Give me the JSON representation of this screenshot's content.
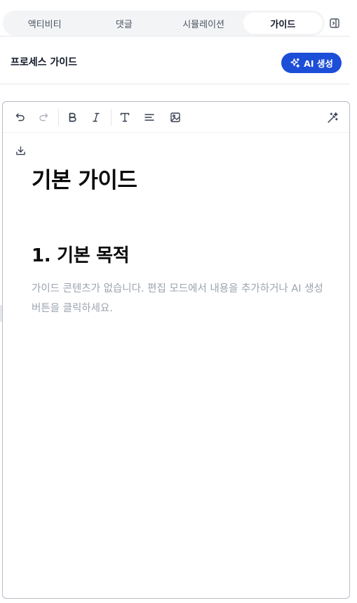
{
  "tabs": [
    {
      "label": "액티비티",
      "active": false
    },
    {
      "label": "댓글",
      "active": false
    },
    {
      "label": "시뮬레이션",
      "active": false
    },
    {
      "label": "가이드",
      "active": true
    }
  ],
  "header": {
    "title": "프로세스 가이드",
    "ai_button_label": "AI 생성"
  },
  "toolbar": {
    "buttons": [
      "undo-icon",
      "redo-icon",
      "bold-icon",
      "italic-icon",
      "heading-icon",
      "align-icon",
      "image-icon",
      "magic-wand-icon"
    ]
  },
  "document": {
    "title": "기본 가이드",
    "section_heading": "1. 기본 목적",
    "placeholder": "가이드 콘텐츠가 없습니다. 편집 모드에서 내용을 추가하거나 AI 생성 버튼을 클릭하세요."
  },
  "colors": {
    "accent": "#1d4ed8",
    "placeholder_text": "#9ca3af"
  }
}
